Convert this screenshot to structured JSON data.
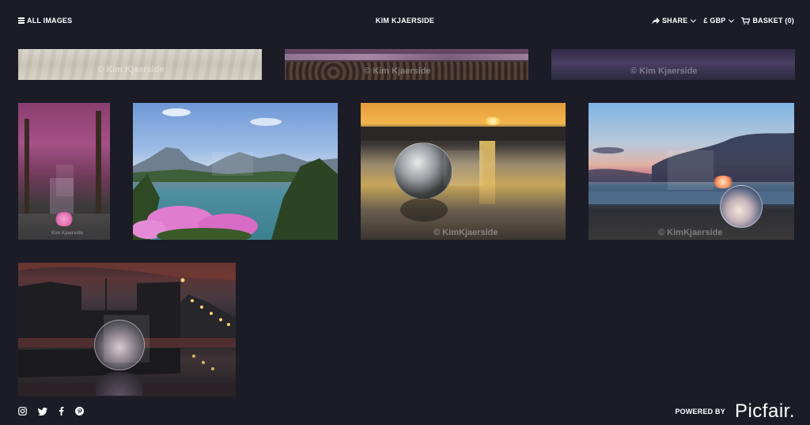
{
  "header": {
    "menu_label": "ALL IMAGES",
    "site_title": "KIM KJAERSIDE",
    "share_label": "SHARE",
    "currency_label": "£ GBP",
    "basket_label": "BASKET (0)"
  },
  "watermarks": {
    "w1": "© Kim Kjaerside",
    "w2": "© Kim Kjaerside",
    "w3": "© Kim Kjaerside",
    "w4": "Kim Kjaerside",
    "w5": "© KimKjaerside",
    "w6": "© KimKjaerside"
  },
  "footer": {
    "powered_label": "POWERED BY",
    "brand": "Picfair."
  },
  "icons": [
    "hamburger-icon",
    "share-icon",
    "basket-icon",
    "instagram-icon",
    "twitter-icon",
    "facebook-icon",
    "pinterest-icon"
  ]
}
